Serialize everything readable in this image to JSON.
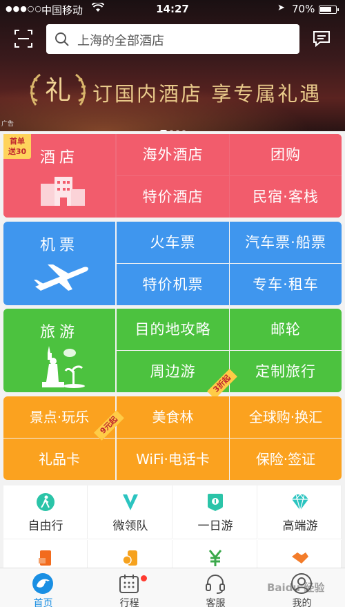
{
  "status_bar": {
    "signal_dots": "●●●○○",
    "carrier": "中国移动",
    "time": "14:27",
    "battery": "70%"
  },
  "search": {
    "placeholder": "上海的全部酒店"
  },
  "banner": {
    "logo_char": "礼",
    "text": "订国内酒店  享专属礼遇",
    "ad_tag": "广告"
  },
  "hotel_row": {
    "main": "酒店",
    "promo": [
      "首单",
      "送30"
    ],
    "items": [
      "海外酒店",
      "团购",
      "特价酒店",
      "民宿·客栈"
    ]
  },
  "flight_row": {
    "main": "机票",
    "items": [
      "火车票",
      "汽车票·船票",
      "特价机票",
      "专车·租车"
    ]
  },
  "travel_row": {
    "main": "旅游",
    "items": [
      "目的地攻略",
      "邮轮",
      "周边游",
      "定制旅行"
    ],
    "ribbon": "3折起"
  },
  "fun_row": {
    "items": [
      "景点·玩乐",
      "美食林",
      "全球购·换汇",
      "礼品卡",
      "WiFi·电话卡",
      "保险·签证"
    ],
    "ribbon": "9元起"
  },
  "sub_grid": {
    "items": [
      {
        "label": "自由行",
        "icon": "walker-icon"
      },
      {
        "label": "微领队",
        "icon": "v-icon"
      },
      {
        "label": "一日游",
        "icon": "flag-icon"
      },
      {
        "label": "高端游",
        "icon": "diamond-icon"
      }
    ]
  },
  "tab_bar": {
    "items": [
      {
        "label": "首页",
        "icon": "dolphin-icon",
        "active": true
      },
      {
        "label": "行程",
        "icon": "calendar-icon"
      },
      {
        "label": "客服",
        "icon": "headset-icon"
      },
      {
        "label": "我的",
        "icon": "profile-icon"
      }
    ]
  },
  "watermark": "Baidu 经验",
  "colors": {
    "hotel": "#f25c6c",
    "flight": "#3f96ee",
    "travel": "#4cc23f",
    "fun": "#fba21f",
    "tab_active": "#1a8fe3",
    "banner_gold": "#e8c98a"
  }
}
